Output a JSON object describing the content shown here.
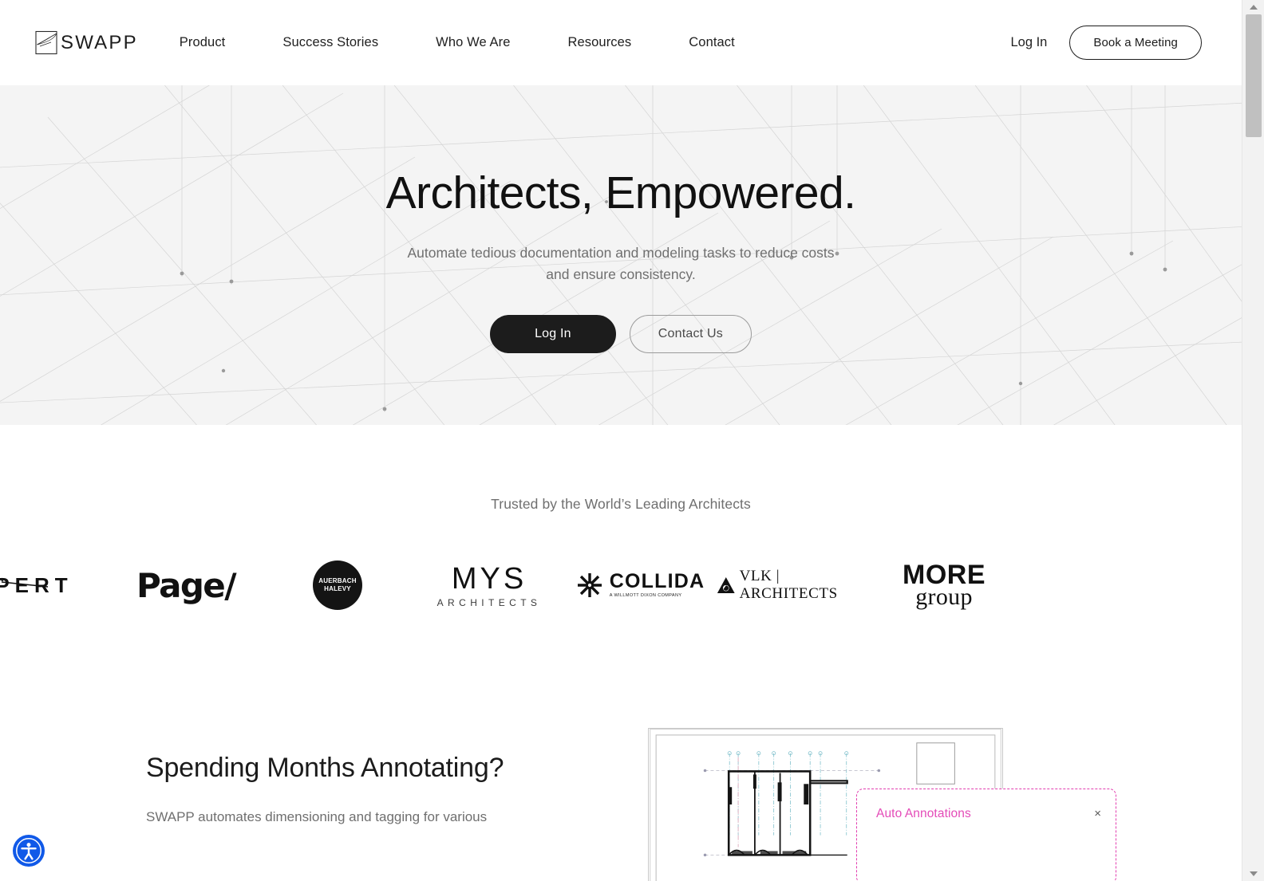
{
  "brand": {
    "name": "SWAPP",
    "logo_icon": "swapp-square-mark"
  },
  "header": {
    "nav": [
      {
        "label": "Product"
      },
      {
        "label": "Success Stories"
      },
      {
        "label": "Who We Are"
      },
      {
        "label": "Resources"
      },
      {
        "label": "Contact"
      }
    ],
    "login_label": "Log In",
    "cta_label": "Book a Meeting"
  },
  "hero": {
    "title": "Architects, Empowered.",
    "subtitle": "Automate tedious documentation and modeling tasks to reduce costs and ensure consistency.",
    "primary_button": "Log In",
    "secondary_button": "Contact Us"
  },
  "trusted": {
    "title": "Trusted by the World’s Leading Architects",
    "logos": [
      {
        "name": "pert-logo",
        "text": "PERT",
        "clipped": true
      },
      {
        "name": "page-logo",
        "text": "Page/"
      },
      {
        "name": "auerbach-halevy-logo",
        "line1": "AUERBACH",
        "line2": "HALEVY"
      },
      {
        "name": "mys-architects-logo",
        "text": "MYS",
        "subtext": "ARCHITECTS"
      },
      {
        "name": "collida-logo",
        "text": "COLLIDA",
        "subtext": "A WILLMOTT DIXON COMPANY"
      },
      {
        "name": "vlk-architects-logo",
        "text": "VLK | ARCHITECTS"
      },
      {
        "name": "more-group-logo",
        "text": "MORE",
        "subtext": "group"
      }
    ]
  },
  "annotating": {
    "title": "Spending Months Annotating?",
    "description": "SWAPP automates dimensioning and tagging for various",
    "popup": {
      "label": "Auto Annotations",
      "close_icon": "×"
    }
  },
  "accessibility": {
    "icon": "accessibility-person-icon",
    "color": "#1059e8"
  },
  "scrollbar": {
    "up_icon": "scroll-up-arrow",
    "down_icon": "scroll-down-arrow"
  },
  "colors": {
    "hero_background": "#f4f4f4",
    "page_background": "#ffffff",
    "text_primary": "#1b1b1b",
    "text_muted": "#6f6f6f",
    "button_dark": "#1c1c1c",
    "accent_pink": "#e44bb8"
  }
}
